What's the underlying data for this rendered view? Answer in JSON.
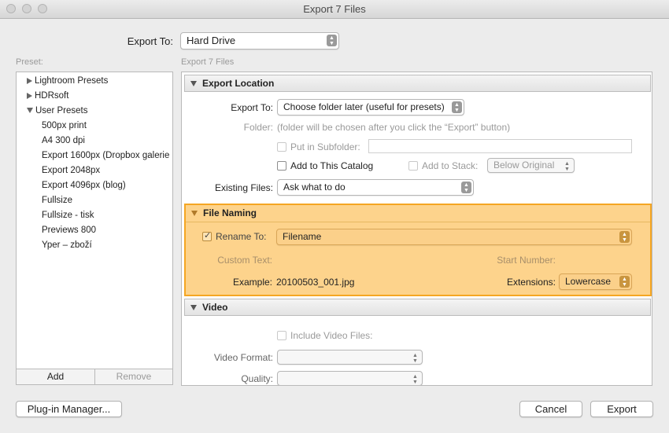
{
  "window": {
    "title": "Export 7 Files"
  },
  "export_to": {
    "label": "Export To:",
    "value": "Hard Drive"
  },
  "preset": {
    "label": "Preset:",
    "items": [
      {
        "label": "Lightroom Presets",
        "kind": "group",
        "expanded": false
      },
      {
        "label": "HDRsoft",
        "kind": "group",
        "expanded": false
      },
      {
        "label": "User Presets",
        "kind": "group",
        "expanded": true
      },
      {
        "label": "500px print",
        "kind": "item"
      },
      {
        "label": "A4 300 dpi",
        "kind": "item"
      },
      {
        "label": "Export 1600px (Dropbox galerie",
        "kind": "item"
      },
      {
        "label": "Export 2048px",
        "kind": "item"
      },
      {
        "label": "Export 4096px (blog)",
        "kind": "item"
      },
      {
        "label": "Fullsize",
        "kind": "item"
      },
      {
        "label": "Fullsize - tisk",
        "kind": "item"
      },
      {
        "label": "Previews 800",
        "kind": "item"
      },
      {
        "label": "Yper – zboží",
        "kind": "item"
      }
    ],
    "add_label": "Add",
    "remove_label": "Remove"
  },
  "panel": {
    "heading": "Export 7 Files"
  },
  "export_location": {
    "title": "Export Location",
    "export_to_label": "Export To:",
    "export_to_value": "Choose folder later (useful for presets)",
    "folder_label": "Folder:",
    "folder_value": "(folder will be chosen after you click the “Export” button)",
    "subfolder_label": "Put in Subfolder:",
    "add_catalog_label": "Add to This Catalog",
    "add_stack_label": "Add to Stack:",
    "stack_value": "Below Original",
    "existing_label": "Existing Files:",
    "existing_value": "Ask what to do"
  },
  "file_naming": {
    "title": "File Naming",
    "rename_label": "Rename To:",
    "rename_value": "Filename",
    "custom_text_label": "Custom Text:",
    "start_number_label": "Start Number:",
    "example_label": "Example:",
    "example_value": "20100503_001.jpg",
    "extensions_label": "Extensions:",
    "extensions_value": "Lowercase"
  },
  "video": {
    "title": "Video",
    "include_label": "Include Video Files:",
    "format_label": "Video Format:",
    "quality_label": "Quality:"
  },
  "footer": {
    "plugin_label": "Plug-in Manager...",
    "cancel_label": "Cancel",
    "export_label": "Export"
  },
  "colors": {
    "highlight_fill": "#fdd38c",
    "highlight_border": "#f5a623"
  }
}
